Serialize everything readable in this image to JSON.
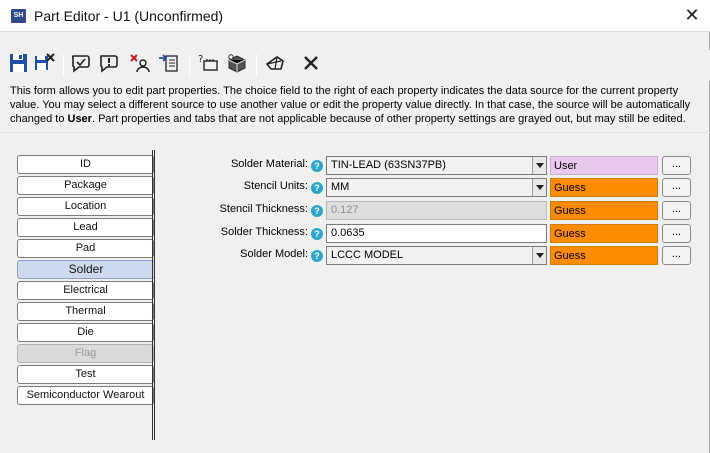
{
  "window": {
    "app_icon_text": "SH",
    "title": "Part Editor - U1 (Unconfirmed)",
    "close_glyph": "✕"
  },
  "toolbar": {
    "buttons": [
      {
        "icon": "save-icon"
      },
      {
        "icon": "save-as-icon"
      },
      {
        "icon": "comment-check-icon"
      },
      {
        "icon": "comment-alert-icon"
      },
      {
        "icon": "clear-user-icon"
      },
      {
        "icon": "import-icon"
      },
      {
        "icon": "rename-part-icon"
      },
      {
        "icon": "package-settings-icon"
      },
      {
        "icon": "3d-view-icon"
      },
      {
        "icon": "close-icon"
      }
    ]
  },
  "description": {
    "part1": "This form allows you to edit part properties. The choice field to the right of each property indicates the data source for the current property value. You may select a different source to use another value or edit the property value directly. In that case, the source will be automatically changed to ",
    "bold": "User",
    "part2": ". Part properties and tabs that are not applicable because of other property settings are grayed out, but may still be edited."
  },
  "tabs": [
    {
      "label": "ID",
      "state": "normal"
    },
    {
      "label": "Package",
      "state": "normal"
    },
    {
      "label": "Location",
      "state": "normal"
    },
    {
      "label": "Lead",
      "state": "normal"
    },
    {
      "label": "Pad",
      "state": "normal"
    },
    {
      "label": "Solder",
      "state": "active"
    },
    {
      "label": "Electrical",
      "state": "normal"
    },
    {
      "label": "Thermal",
      "state": "normal"
    },
    {
      "label": "Die",
      "state": "normal"
    },
    {
      "label": "Flag",
      "state": "disabled"
    },
    {
      "label": "Test",
      "state": "normal"
    },
    {
      "label": "Semiconductor Wearout",
      "state": "normal"
    }
  ],
  "fields": [
    {
      "label": "Solder Material:",
      "value": "TIN-LEAD (63SN37PB)",
      "control": "select",
      "source": "User",
      "more": "..."
    },
    {
      "label": "Stencil Units:",
      "value": "MM",
      "control": "select",
      "source": "Guess",
      "more": "..."
    },
    {
      "label": "Stencil Thickness:",
      "value": "0.127",
      "control": "disabled",
      "source": "Guess",
      "more": "..."
    },
    {
      "label": "Solder Thickness:",
      "value": "0.0635",
      "control": "text",
      "source": "Guess",
      "more": "..."
    },
    {
      "label": "Solder Model:",
      "value": "LCCC MODEL",
      "control": "select",
      "source": "Guess",
      "more": "..."
    }
  ],
  "colors": {
    "source_guess": "#ff8c00",
    "source_user": "#e8c8ec",
    "active_tab": "#cdd9ec",
    "help_icon": "#2aa6c8"
  }
}
